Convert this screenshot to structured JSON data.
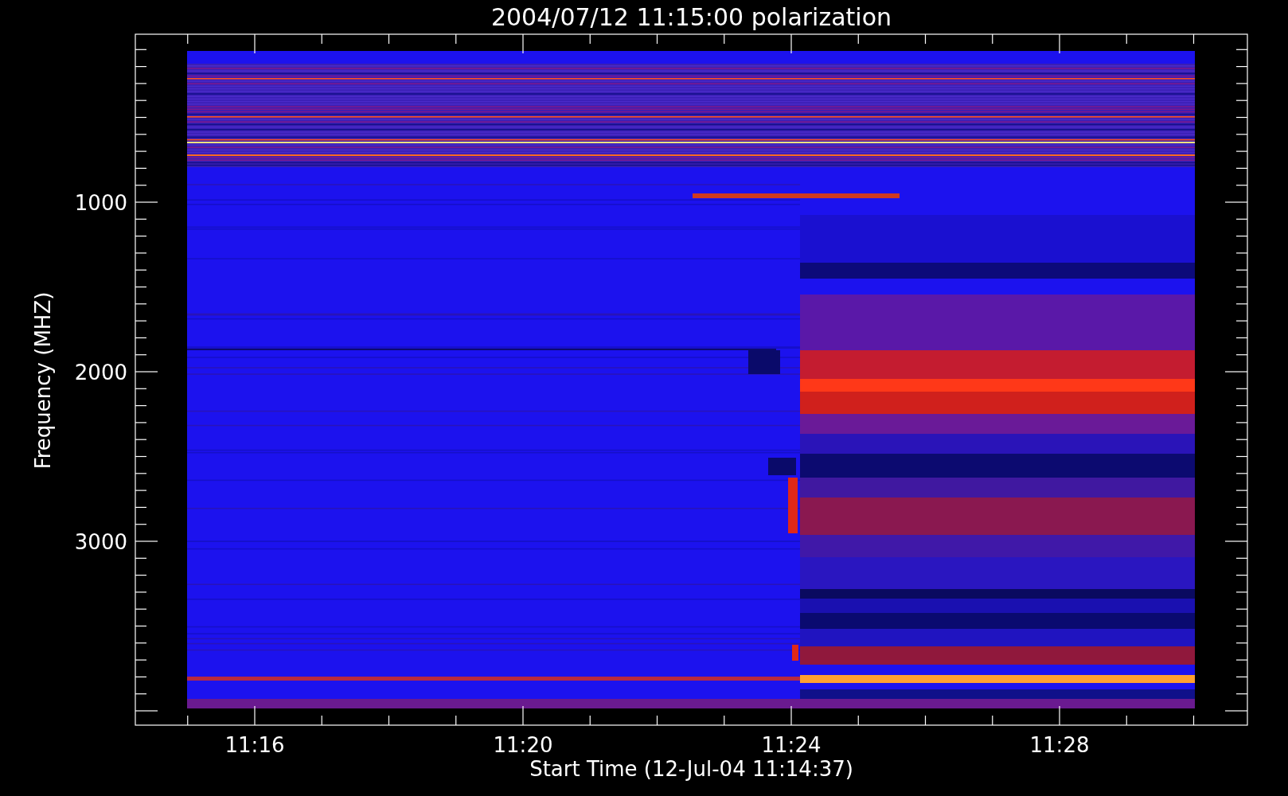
{
  "title": "2004/07/12 11:15:00 polarization",
  "y_axis": {
    "label": "Frequency (MHZ)",
    "ticks": [
      "1000",
      "2000",
      "3000"
    ]
  },
  "x_axis": {
    "label": "Start Time (12-Jul-04 11:14:37)",
    "ticks": [
      "11:16",
      "11:20",
      "11:24",
      "11:28"
    ]
  }
}
